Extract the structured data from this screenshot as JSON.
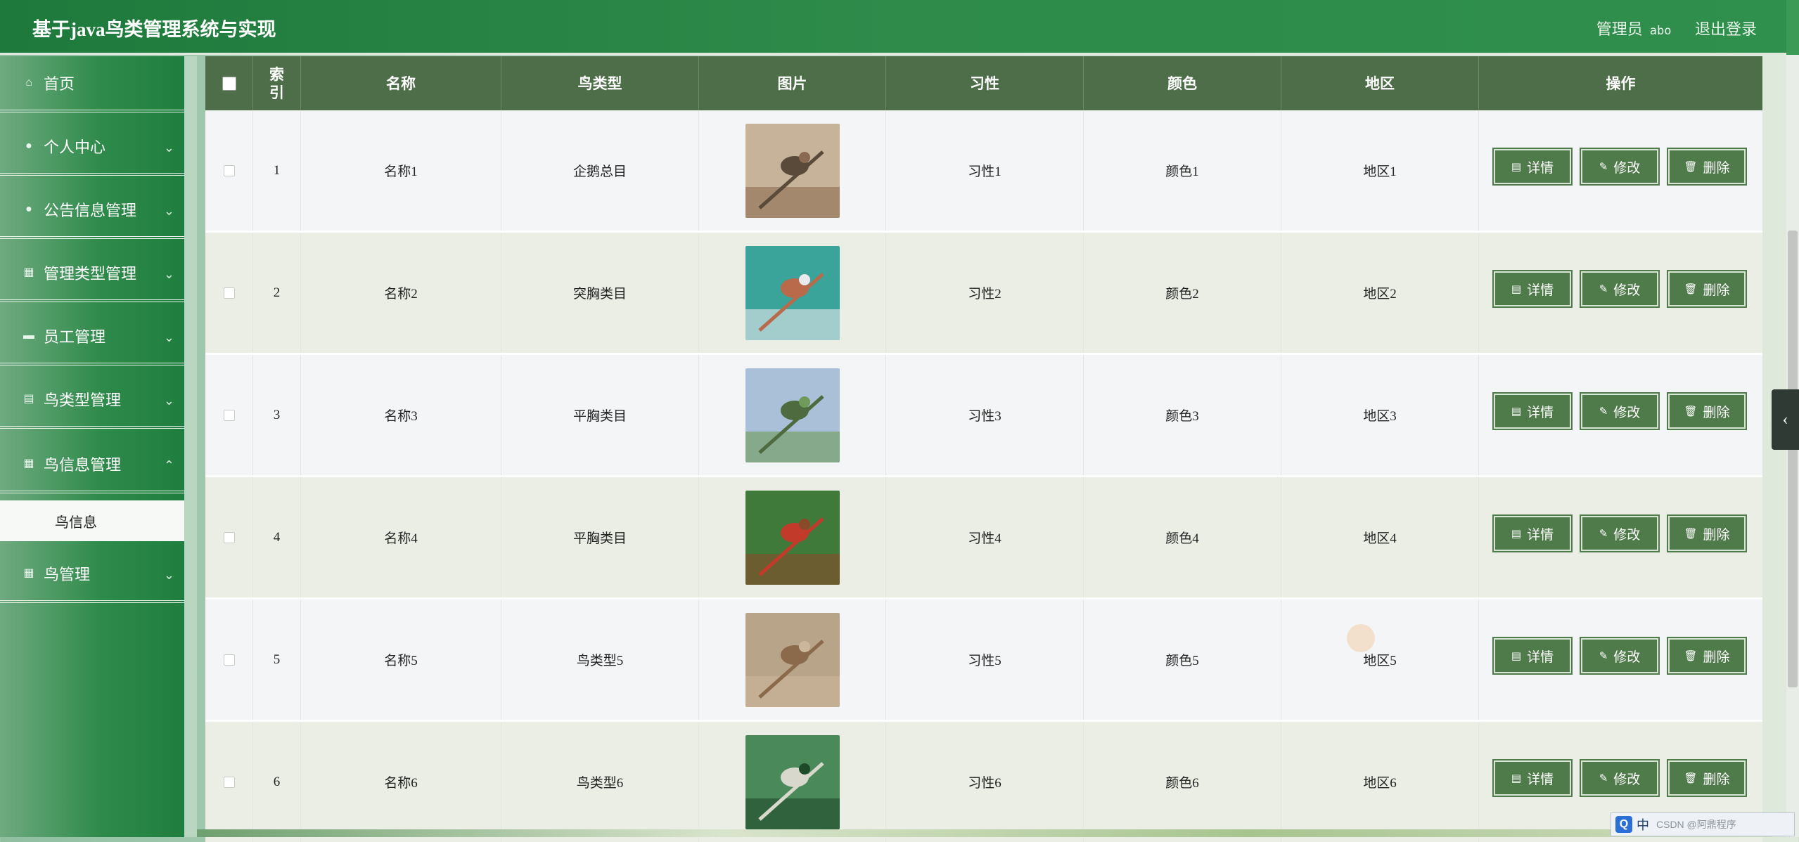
{
  "header": {
    "title": "基于java鸟类管理系统与实现",
    "role_label": "管理员",
    "username": "abo",
    "logout_label": "退出登录"
  },
  "sidebar": {
    "items": [
      {
        "label": "首页",
        "icon": "home-icon"
      },
      {
        "label": "个人中心",
        "icon": "user-icon"
      },
      {
        "label": "公告信息管理",
        "icon": "user-icon"
      },
      {
        "label": "管理类型管理",
        "icon": "grid-icon"
      },
      {
        "label": "员工管理",
        "icon": "ticket-icon"
      },
      {
        "label": "鸟类型管理",
        "icon": "clipboard-icon"
      },
      {
        "label": "鸟信息管理",
        "icon": "grid-icon"
      },
      {
        "label": "鸟管理",
        "icon": "grid-icon"
      }
    ],
    "active_subitem": "鸟信息"
  },
  "table": {
    "columns": [
      "索引",
      "名称",
      "鸟类型",
      "图片",
      "习性",
      "颜色",
      "地区",
      "操作"
    ],
    "rows": [
      {
        "index": "1",
        "name": "名称1",
        "type": "企鹅总目",
        "habit": "习性1",
        "color": "颜色1",
        "region": "地区1"
      },
      {
        "index": "2",
        "name": "名称2",
        "type": "突胸类目",
        "habit": "习性2",
        "color": "颜色2",
        "region": "地区2"
      },
      {
        "index": "3",
        "name": "名称3",
        "type": "平胸类目",
        "habit": "习性3",
        "color": "颜色3",
        "region": "地区3"
      },
      {
        "index": "4",
        "name": "名称4",
        "type": "平胸类目",
        "habit": "习性4",
        "color": "颜色4",
        "region": "地区4"
      },
      {
        "index": "5",
        "name": "名称5",
        "type": "鸟类型5",
        "habit": "习性5",
        "color": "颜色5",
        "region": "地区5"
      },
      {
        "index": "6",
        "name": "名称6",
        "type": "鸟类型6",
        "habit": "习性6",
        "color": "颜色6",
        "region": "地区6"
      }
    ],
    "actions": {
      "detail": "详情",
      "edit": "修改",
      "delete": "删除"
    }
  },
  "ime": {
    "lang": "中",
    "watermark": "CSDN @阿鼎程序"
  },
  "colors": {
    "header": "#2e8b4a",
    "table_head": "#4d6e48",
    "button": "#4f7a4a"
  }
}
